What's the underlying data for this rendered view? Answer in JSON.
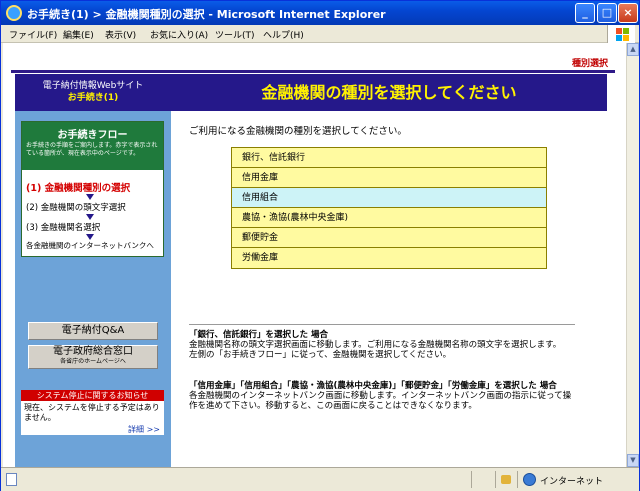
{
  "window": {
    "title": "お手続き(1) > 金融機関種別の選択 - Microsoft Internet Explorer",
    "controls": [
      "_",
      "□",
      "×"
    ]
  },
  "menubar": [
    "ファイル(F)",
    "編集(E)",
    "表示(V)",
    "お気に入り(A)",
    "ツール(T)",
    "ヘルプ(H)"
  ],
  "page": {
    "page_label": "種別選択",
    "banner_left": {
      "line1": "電子納付情報Webサイト",
      "line2": "お手続き(1)"
    },
    "banner_title": "金融機関の種別を選択してください",
    "flow": {
      "title": "お手続きフロー",
      "description": "お手続きの手順をご案内します。赤字で表示されている箇所が、現在表示中のページです。",
      "steps": [
        "(1) 金融機関種別の選択",
        "(2) 金融機関の頭文字選択",
        "(3) 金融機関名選択",
        "各金融機関のインターネットバンクへ"
      ]
    },
    "side_buttons": {
      "qa": "電子納付Q&A",
      "portal_main": "電子政府総合窓口",
      "portal_sub": "各省庁のホームページへ"
    },
    "notice": {
      "title": "システム停止に関するお知らせ",
      "body": "現在、システムを停止する予定はありません。",
      "more": "詳細 >>"
    },
    "intro": "ご利用になる金融機関の種別を選択してください。",
    "options": [
      "銀行、信託銀行",
      "信用金庫",
      "信用組合",
      "農協・漁協(農林中央金庫)",
      "郵便貯金",
      "労働金庫"
    ],
    "info1": {
      "heading": "「銀行、信託銀行」を選択した 場合",
      "line1": "金融機関名称の頭文字選択画面に移動します。ご利用になる金融機関名称の頭文字を選択します。",
      "line2": "左側の「お手続きフロー」に従って、金融機関を選択してください。"
    },
    "info2": {
      "heading": "「信用金庫」「信用組合」「農協・漁協(農林中央金庫)」「郵便貯金」「労働金庫」を選択した 場合",
      "line1": "各金融機関のインターネットバンク画面に移動します。インターネットバンク画面の指示に従って操作を進めて下さい。移動すると、この画面に戻ることはできなくなります。"
    }
  },
  "statusbar": {
    "zone": "インターネット"
  },
  "colors": {
    "banner": "#25188a",
    "banner_title": "#fff200",
    "option_bg": "#fffaa0",
    "option_hover": "#cdf3f7",
    "sidebar": "#6da3d8",
    "flow_head": "#1f7a3c",
    "active_step": "#d40000",
    "notice_head": "#d00000"
  },
  "icons": {
    "ie": "ie-icon",
    "windows": "windows-logo-icon",
    "page": "page-icon",
    "lock": "lock-icon",
    "globe": "globe-icon"
  }
}
